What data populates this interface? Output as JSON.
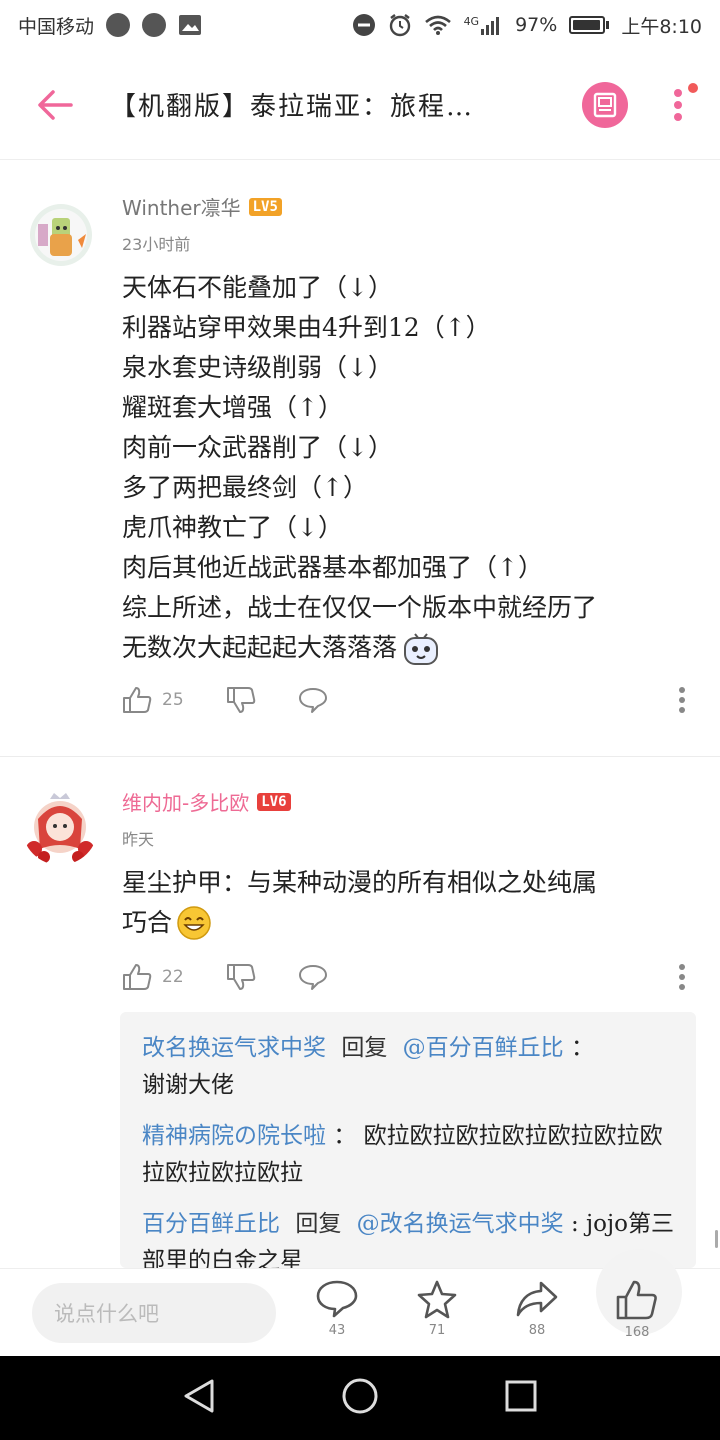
{
  "status_bar": {
    "carrier": "中国移动",
    "network": "4G",
    "battery_percent": "97%",
    "time": "上午8:10"
  },
  "header": {
    "title": "【机翻版】泰拉瑞亚：旅程…"
  },
  "comments": [
    {
      "username": "Winther凛华",
      "level": "LV5",
      "time": "23小时前",
      "lines": [
        "天体石不能叠加了（↓）",
        "利器站穿甲效果由4升到12（↑）",
        "泉水套史诗级削弱（↓）",
        "耀斑套大增强（↑）",
        "肉前一众武器削了（↓）",
        "多了两把最终剑（↑）",
        "虎爪神教亡了（↓）",
        "肉后其他近战武器基本都加强了（↑）",
        "综上所述，战士在仅仅一个版本中就经历了",
        "无数次大起起起大落落落"
      ],
      "likes": "25"
    },
    {
      "username": "维内加-多比欧",
      "level": "LV6",
      "time": "昨天",
      "lines": [
        "星尘护甲：与某种动漫的所有相似之处纯属",
        "巧合"
      ],
      "likes": "22"
    }
  ],
  "replies": [
    {
      "user": "改名换运气求中奖",
      "verb": "回复",
      "target": "@百分百鲜丘比",
      "sep": "：",
      "text": "谢谢大佬"
    },
    {
      "user": "精神病院の院长啦",
      "sep": "：",
      "text": "欧拉欧拉欧拉欧拉欧拉欧拉欧拉欧拉欧拉欧拉"
    },
    {
      "user": "百分百鲜丘比",
      "verb": "回复",
      "target": "@改名换运气求中奖",
      "sep": " :",
      "text": "jojo第三部里的白金之星"
    }
  ],
  "bottom_bar": {
    "input_placeholder": "说点什么吧",
    "comment_count": "43",
    "favorite_count": "71",
    "share_count": "88",
    "like_count": "168"
  },
  "colors": {
    "accent_pink": "#f0679a",
    "reply_user_blue": "#4a86c5",
    "level5": "#f2a227",
    "level6": "#e8403c"
  },
  "icons": [
    "back-arrow-icon",
    "cover-image-icon",
    "more-vertical-icon",
    "thumbs-up-icon",
    "thumbs-down-icon",
    "comment-bubble-icon",
    "star-icon",
    "share-icon"
  ]
}
